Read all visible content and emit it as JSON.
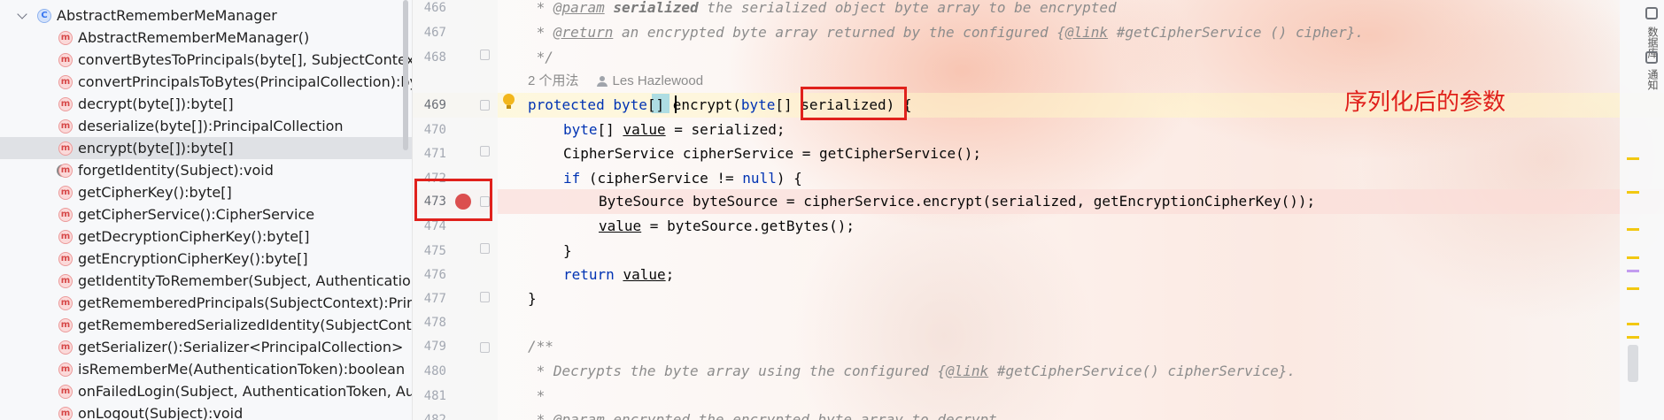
{
  "structure": {
    "class_name": "AbstractRememberMeManager",
    "selected_index": 6,
    "methods": [
      {
        "name": "AbstractRememberMeManager()",
        "locked": false
      },
      {
        "name": "convertBytesToPrincipals(byte[], SubjectContext):Pri",
        "locked": false
      },
      {
        "name": "convertPrincipalsToBytes(PrincipalCollection):byte[]",
        "locked": false
      },
      {
        "name": "decrypt(byte[]):byte[]",
        "locked": false
      },
      {
        "name": "deserialize(byte[]):PrincipalCollection",
        "locked": false
      },
      {
        "name": "encrypt(byte[]):byte[]",
        "locked": false
      },
      {
        "name": "forgetIdentity(Subject):void",
        "locked": true
      },
      {
        "name": "getCipherKey():byte[]",
        "locked": false
      },
      {
        "name": "getCipherService():CipherService",
        "locked": false
      },
      {
        "name": "getDecryptionCipherKey():byte[]",
        "locked": false
      },
      {
        "name": "getEncryptionCipherKey():byte[]",
        "locked": false
      },
      {
        "name": "getIdentityToRemember(Subject, AuthenticationInfo",
        "locked": false
      },
      {
        "name": "getRememberedPrincipals(SubjectContext):Principa",
        "locked": false
      },
      {
        "name": "getRememberedSerializedIdentity(SubjectContext):b",
        "locked": false
      },
      {
        "name": "getSerializer():Serializer<PrincipalCollection>",
        "locked": false
      },
      {
        "name": "isRememberMe(AuthenticationToken):boolean",
        "locked": false
      },
      {
        "name": "onFailedLogin(Subject, AuthenticationToken, Auther",
        "locked": false
      },
      {
        "name": "onLogout(Subject):void",
        "locked": false
      }
    ]
  },
  "editor": {
    "line_numbers": [
      "466",
      "467",
      "468",
      "469",
      "470",
      "471",
      "472",
      "473",
      "474",
      "475",
      "476",
      "477",
      "478",
      "479",
      "480",
      "481",
      "482"
    ],
    "usage_hint": "2 个用法",
    "author": "Les Hazlewood",
    "annotation": "序列化后的参数",
    "lines": {
      "l466_tag": "@param",
      "l466_a": " * ",
      "l466_b": " serialized",
      "l466_c": " the serialized object byte array to be encrypted",
      "l467_a": " * ",
      "l467_tag": "@return",
      "l467_b": " an encrypted byte array returned by the configured {",
      "l467_link": "@link",
      "l467_c": " #getCipherService () cipher}.",
      "l468": " */",
      "l469_kw1": "protected",
      "l469_kw2": "byte",
      "l469_br": "[]",
      "l469_name": "encrypt(",
      "l469_kw3": "byte",
      "l469_br2": "[]",
      "l469_param": " serialized",
      "l469_end": ") {",
      "l470_kw": "byte",
      "l470_a": "[] ",
      "l470_var": "value",
      "l470_b": " = serialized;",
      "l471": "CipherService cipherService = getCipherService();",
      "l472_kw": "if",
      "l472_a": " (cipherService != ",
      "l472_null": "null",
      "l472_b": ") {",
      "l473": "ByteSource byteSource = cipherService.encrypt(serialized, getEncryptionCipherKey());",
      "l474_var": "value",
      "l474_b": " = byteSource.getBytes();",
      "l475": "}",
      "l476_kw": "return",
      "l476_var": "value",
      "l476_b": ";",
      "l477": "}",
      "l479": "/**",
      "l480_a": " * Decrypts the byte array using the configured {",
      "l480_link": "@link",
      "l480_b": " #getCipherService() cipherService}.",
      "l481": " *",
      "l482_a": " * ",
      "l482_tag": "@param",
      "l482_b": " encrypted the encrypted byte array to decrypt"
    }
  },
  "right_stripe": {
    "tool_labels": [
      "数据库",
      "通知"
    ]
  },
  "colors": {
    "annotation_red": "#e0211c",
    "keyword_blue": "#0033b3",
    "breakpoint_red": "#db4f4f",
    "warning_yellow": "#f2b61c"
  }
}
